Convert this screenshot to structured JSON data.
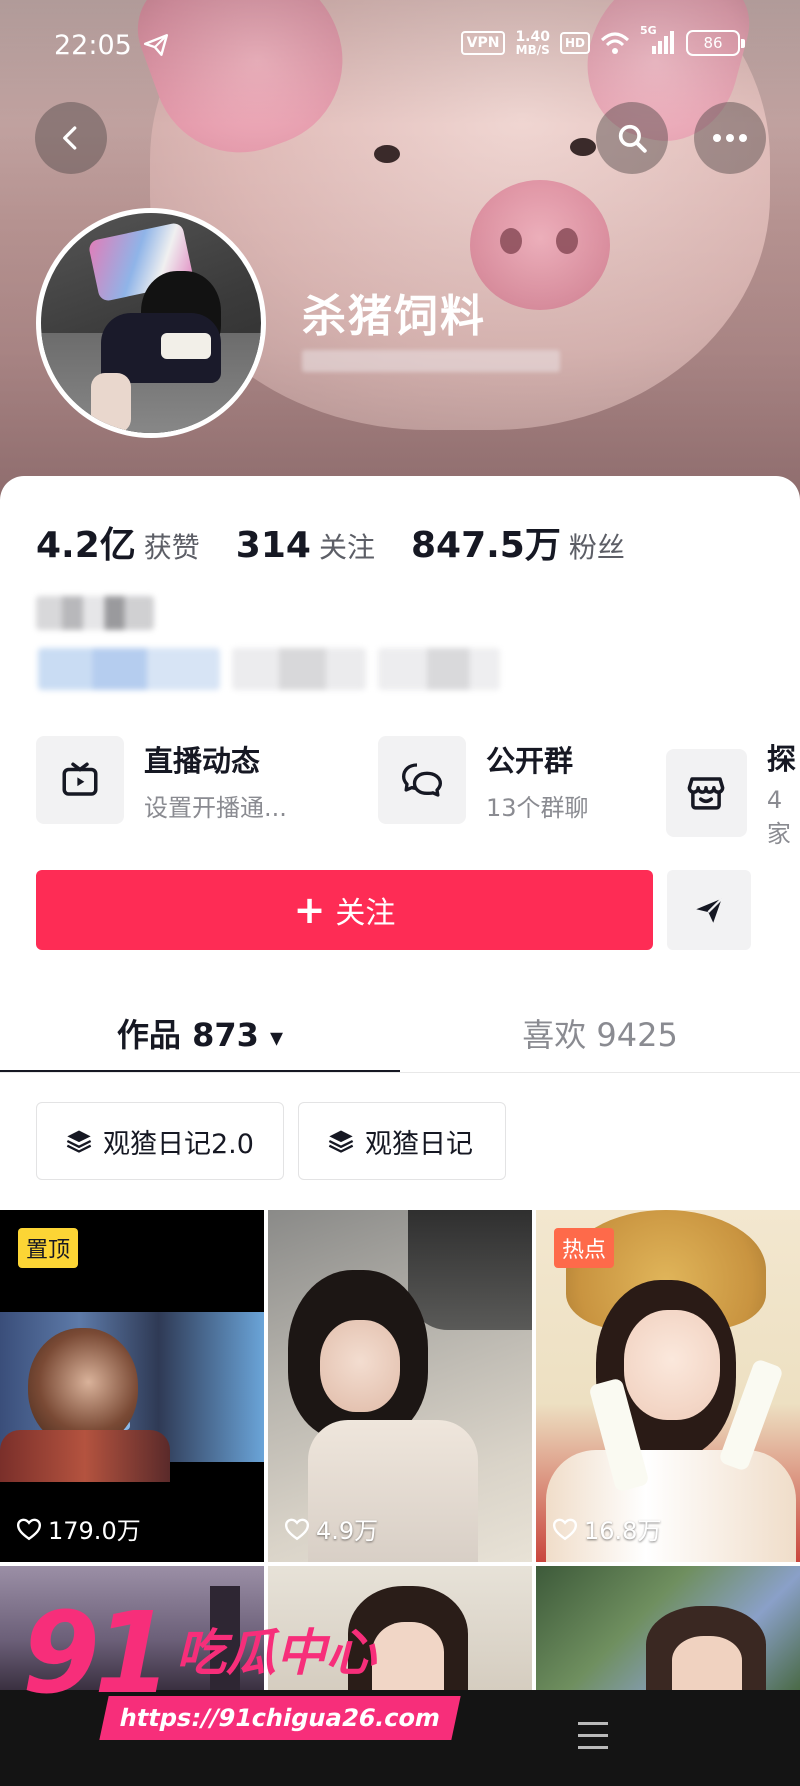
{
  "status_bar": {
    "time": "22:05",
    "vpn": "VPN",
    "speed_top": "1.40",
    "speed_bottom": "MB/S",
    "hd": "HD",
    "network": "5G",
    "battery": "86"
  },
  "profile": {
    "name": "杀猪饲料",
    "stats": [
      {
        "value": "4.2亿",
        "label": "获赞"
      },
      {
        "value": "314",
        "label": "关注"
      },
      {
        "value": "847.5万",
        "label": "粉丝"
      }
    ]
  },
  "shortcuts": [
    {
      "title": "直播动态",
      "subtitle": "设置开播通...",
      "icon": "tv-icon"
    },
    {
      "title": "公开群",
      "subtitle": "13个群聊",
      "icon": "chat-bubbles-icon"
    },
    {
      "title": "探",
      "subtitle": "4家",
      "icon": "shop-icon"
    }
  ],
  "actions": {
    "follow_plus": "+",
    "follow_label": "关注"
  },
  "tabs": [
    {
      "label": "作品 873",
      "arrow": "▾",
      "active": true
    },
    {
      "label": "喜欢 9425",
      "active": false
    }
  ],
  "collections": [
    {
      "label": "观猹日记2.0"
    },
    {
      "label": "观猹日记"
    }
  ],
  "videos": [
    {
      "badge": "置顶",
      "likes": "179.0万"
    },
    {
      "badge": "",
      "likes": "4.9万"
    },
    {
      "badge": "热点",
      "likes": "16.8万"
    },
    {
      "badge": "",
      "likes": ""
    },
    {
      "badge": "",
      "likes": ""
    },
    {
      "badge": "",
      "likes": ""
    }
  ],
  "watermark": {
    "number": "91",
    "name": "吃瓜中心",
    "url": "https://91chigua26.com"
  },
  "colors": {
    "follow_button": "#fe2c55",
    "pin_badge": "#fcd535",
    "hot_badge": "#fe6a4a",
    "watermark": "#f72e7a"
  }
}
